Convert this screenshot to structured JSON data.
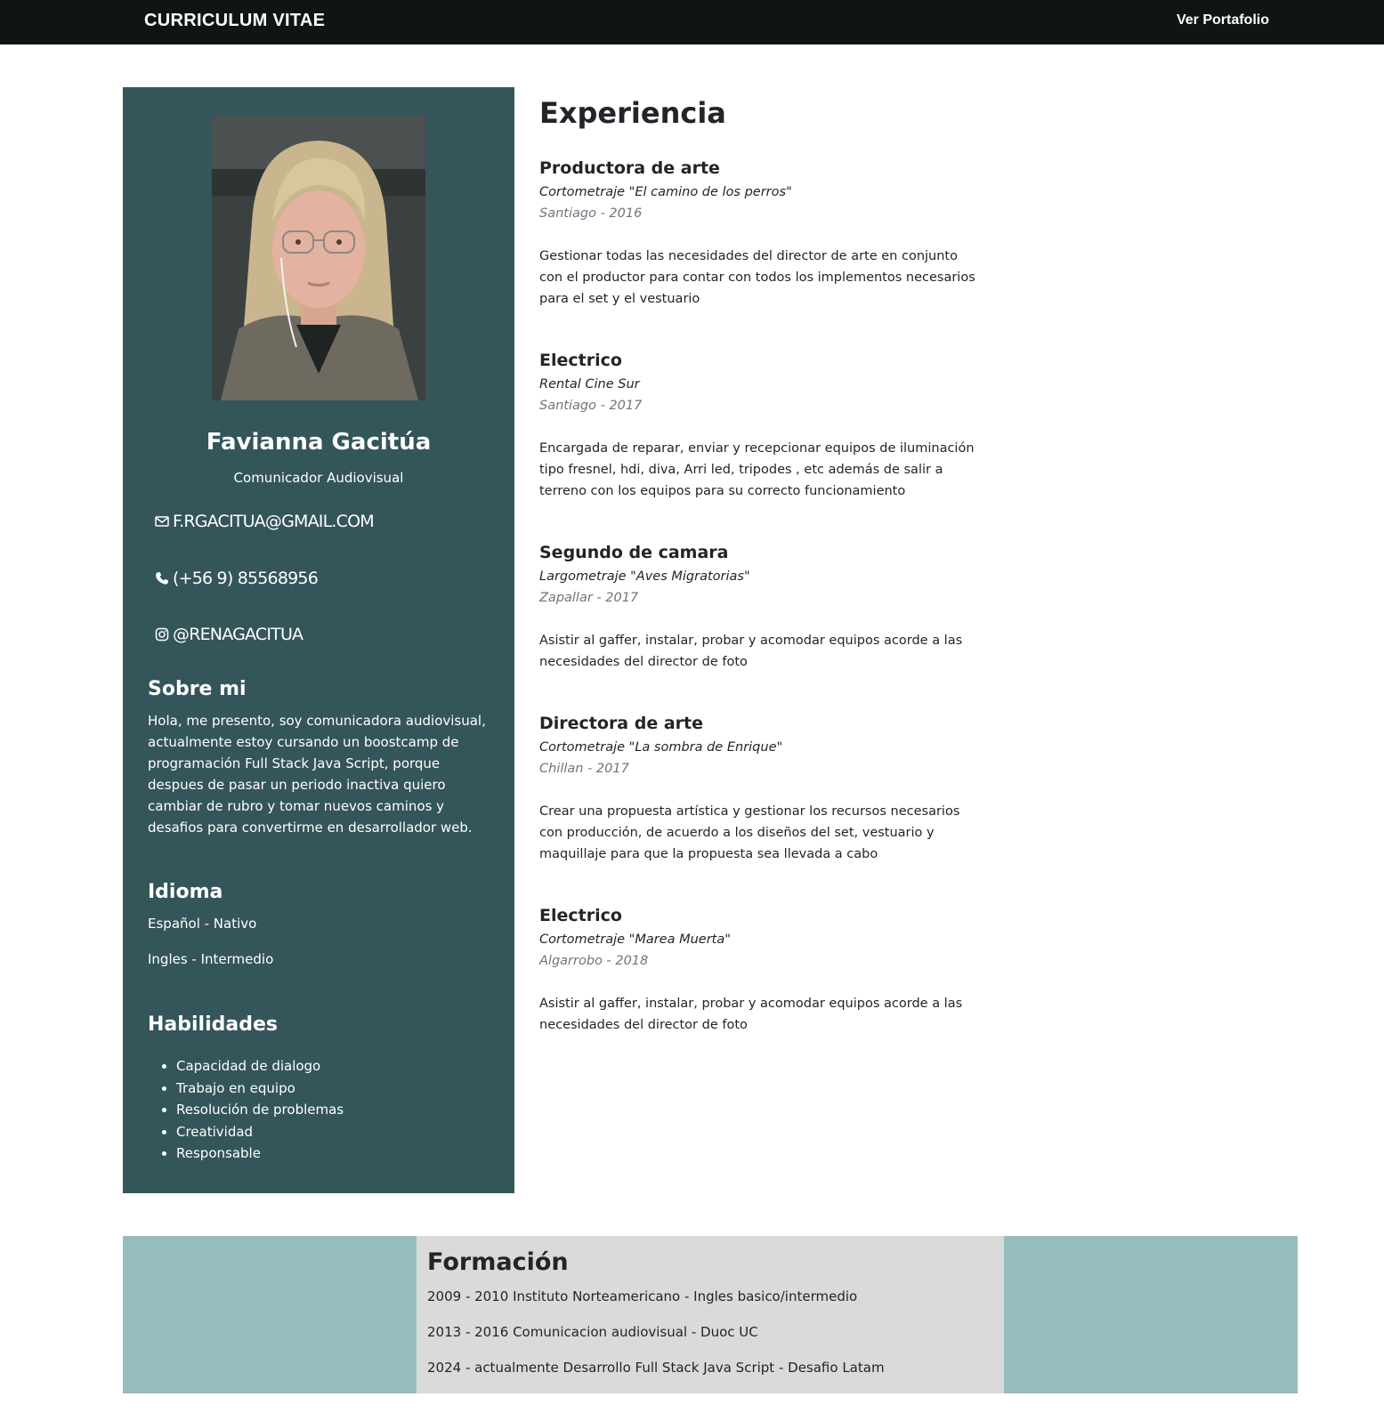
{
  "navbar": {
    "brand": "CURRICULUM VITAE",
    "portfolio_link": "Ver Portafolio"
  },
  "profile": {
    "name": "Favianna Gacitúa",
    "role": "Comunicador Audiovisual",
    "email": "F.RGACITUA@GMAIL.COM",
    "phone": "(+56 9) 85568956",
    "instagram": "@RENAGACITUA"
  },
  "about": {
    "heading": "Sobre mi",
    "text": "Hola, me presento, soy comunicadora audiovisual, actualmente estoy cursando un boostcamp de programación Full Stack Java Script, porque despues de pasar un periodo inactiva quiero cambiar de rubro y tomar nuevos caminos y desafios para convertirme en desarrollador web."
  },
  "languages": {
    "heading": "Idioma",
    "items": [
      "Español - Nativo",
      "Ingles - Intermedio"
    ]
  },
  "skills": {
    "heading": "Habilidades",
    "items": [
      "Capacidad de dialogo",
      "Trabajo en equipo",
      "Resolución de problemas",
      "Creatividad",
      "Responsable"
    ]
  },
  "experience": {
    "heading": "Experiencia",
    "jobs": [
      {
        "title": "Productora de arte",
        "project": "Cortometraje \"El camino de los perros\"",
        "location": "Santiago - 2016",
        "description": "Gestionar todas las necesidades del director de arte en conjunto con el productor para contar con todos los implementos necesarios para el set y el vestuario"
      },
      {
        "title": "Electrico",
        "project": "Rental Cine Sur",
        "location": "Santiago - 2017",
        "description": "Encargada de reparar, enviar y recepcionar equipos de iluminación tipo fresnel, hdi, diva, Arri led, tripodes , etc además de salir a terreno con los equipos para su correcto funcionamiento"
      },
      {
        "title": "Segundo de camara",
        "project": "Largometraje \"Aves Migratorias\"",
        "location": "Zapallar - 2017",
        "description": "Asistir al gaffer, instalar, probar y acomodar equipos acorde a las necesidades del director de foto"
      },
      {
        "title": "Directora de arte",
        "project": "Cortometraje \"La sombra de Enrique\"",
        "location": "Chillan - 2017",
        "description": "Crear una propuesta artística y gestionar los recursos necesarios con producción, de acuerdo a los diseños del set, vestuario y maquillaje para que la propuesta sea llevada a cabo"
      },
      {
        "title": "Electrico",
        "project": "Cortometraje \"Marea Muerta\"",
        "location": "Algarrobo - 2018",
        "description": "Asistir al gaffer, instalar, probar y acomodar equipos acorde a las necesidades del director de foto"
      }
    ]
  },
  "education": {
    "heading": "Formación",
    "items": [
      "2009 - 2010 Instituto Norteamericano - Ingles basico/intermedio",
      "2013 - 2016 Comunicacion audiovisual - Duoc UC",
      "2024 - actualmente Desarrollo Full Stack Java Script - Desafio Latam"
    ]
  },
  "colors": {
    "navbar_bg": "#0f1514",
    "sidebar_bg": "#34555a",
    "band_bg": "#95bdbb",
    "formacion_bg": "#dadada"
  }
}
